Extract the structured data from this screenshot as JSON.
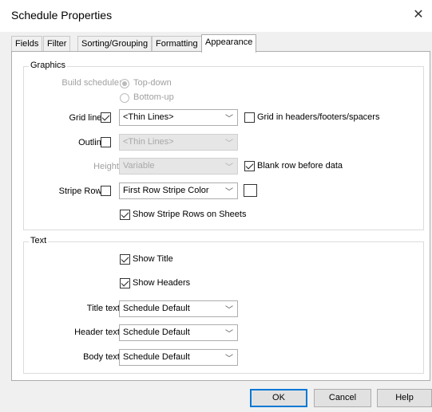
{
  "window": {
    "title": "Schedule Properties",
    "close_glyph": "✕"
  },
  "tabs": [
    "Fields",
    "Filter",
    "Sorting/Grouping",
    "Formatting",
    "Appearance"
  ],
  "active_tab": "Appearance",
  "graphics": {
    "legend": "Graphics",
    "build_schedule": {
      "label": "Build schedule:",
      "options": [
        "Top-down",
        "Bottom-up"
      ],
      "selected": "Top-down",
      "enabled": false
    },
    "grid_lines": {
      "label": "Grid lines:",
      "checked": true,
      "value": "<Thin Lines>",
      "extra_label": "Grid in headers/footers/spacers",
      "extra_checked": false
    },
    "outline": {
      "label": "Outline:",
      "checked": false,
      "value": "<Thin Lines>",
      "value_enabled": false
    },
    "height": {
      "label": "Height:",
      "value": "Variable",
      "enabled": false,
      "extra_label": "Blank row before data",
      "extra_checked": true
    },
    "stripe_rows": {
      "label": "Stripe Rows:",
      "checked": false,
      "value": "First Row Stripe Color",
      "color": "#ffffff"
    },
    "show_stripe": {
      "label": "Show Stripe Rows on Sheets",
      "checked": true
    }
  },
  "text": {
    "legend": "Text",
    "show_title": {
      "label": "Show Title",
      "checked": true
    },
    "show_headers": {
      "label": "Show Headers",
      "checked": true
    },
    "title_text": {
      "label": "Title text:",
      "value": "Schedule Default"
    },
    "header_text": {
      "label": "Header text:",
      "value": "Schedule Default"
    },
    "body_text": {
      "label": "Body text:",
      "value": "Schedule Default"
    }
  },
  "buttons": {
    "ok": "OK",
    "cancel": "Cancel",
    "help": "Help"
  },
  "colors": {
    "accent": "#0078d7",
    "disabled_text": "#a0a0a0"
  }
}
